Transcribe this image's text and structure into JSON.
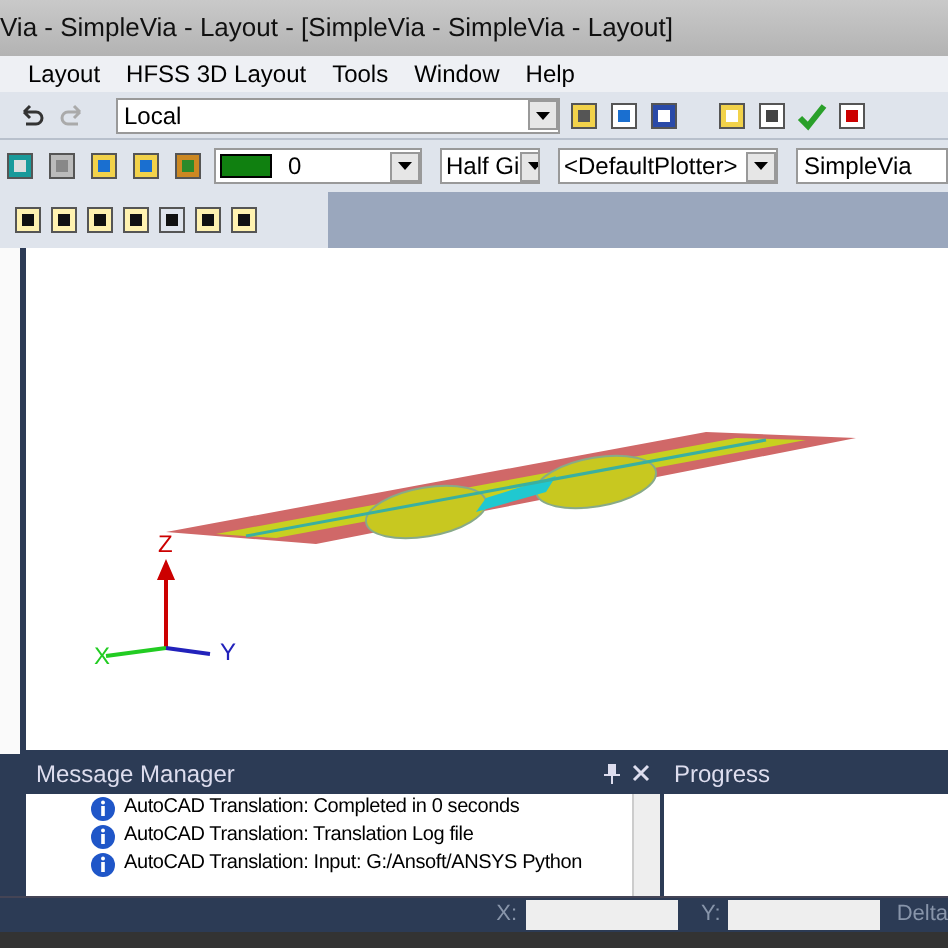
{
  "window": {
    "title": "Via - SimpleVia - Layout - [SimpleVia - SimpleVia - Layout]"
  },
  "menu": [
    "Layout",
    "HFSS 3D Layout",
    "Tools",
    "Window",
    "Help"
  ],
  "toolbar1": {
    "location": "Local"
  },
  "toolbar2": {
    "layer": "0",
    "grid": "Half Gi",
    "plotter": "<DefaultPlotter>",
    "design": "SimpleVia"
  },
  "viewport": {
    "axes": {
      "z": "Z",
      "x": "X",
      "y": "Y"
    }
  },
  "message_manager": {
    "title": "Message Manager",
    "messages": [
      {
        "text": "AutoCAD Translation: Completed in 0 seconds"
      },
      {
        "text": "AutoCAD Translation: Translation Log file"
      },
      {
        "text": "AutoCAD Translation: Input: G:/Ansoft/ANSYS Python"
      }
    ]
  },
  "progress": {
    "title": "Progress"
  },
  "status_bar": {
    "x_label": "X:",
    "y_label": "Y:",
    "delta_label": "Delta"
  }
}
